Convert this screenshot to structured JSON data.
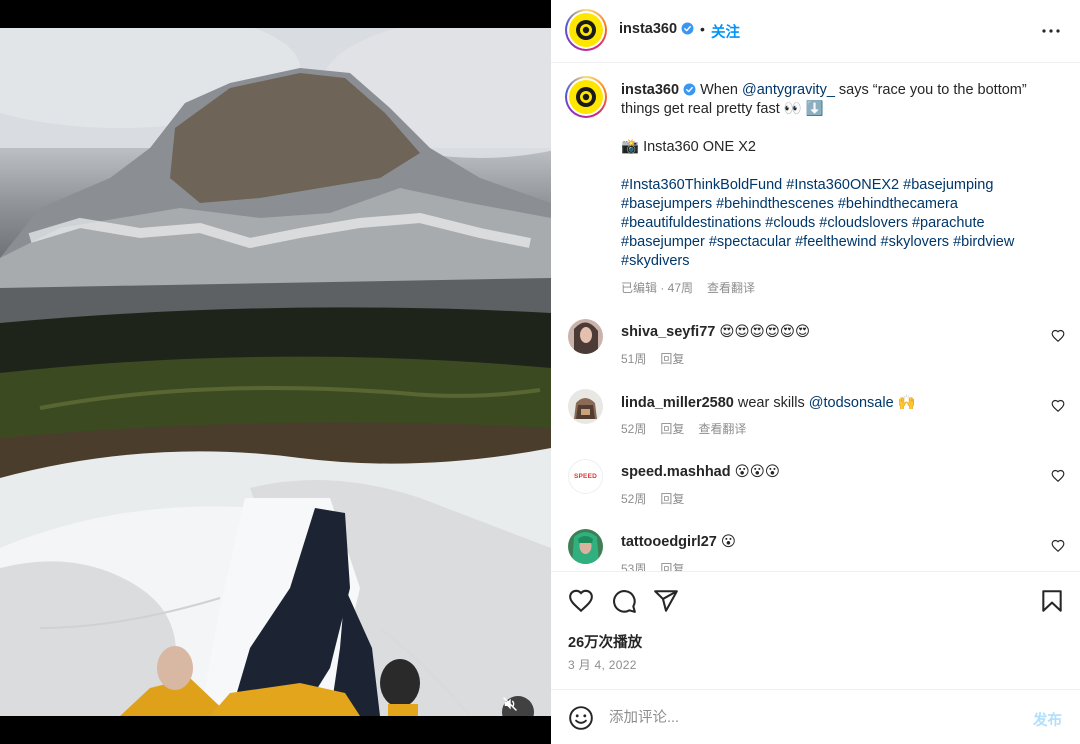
{
  "header": {
    "username": "insta360",
    "separator": "•",
    "follow_label": "关注"
  },
  "caption": {
    "username": "insta360",
    "text_before": "When ",
    "mention": "@antygravity_",
    "text_after": " says “race you to the bottom” things get real pretty fast 👀 ⬇️",
    "camera_line": "📸 Insta360 ONE X2",
    "hashtags": "#Insta360ThinkBoldFund #Insta360ONEX2 #basejumping #basejumpers #behindthescenes #behindthecamera #beautifuldestinations #clouds #cloudslovers #parachute #basejumper #spectacular #feelthewind #skylovers #birdview #skydivers",
    "edited_time": "已编辑 · 47周",
    "see_translation": "查看翻译"
  },
  "comments": [
    {
      "username": "shiva_seyfi77",
      "text": "😍😍😍😍😍😍",
      "mention": "",
      "time": "51周",
      "reply": "回复",
      "translate": ""
    },
    {
      "username": "linda_miller2580",
      "text": "wear skills ",
      "mention": "@todsonsale",
      "text_after": " 🙌",
      "time": "52周",
      "reply": "回复",
      "translate": "查看翻译"
    },
    {
      "username": "speed.mashhad",
      "text": "😮😮😮",
      "mention": "",
      "time": "52周",
      "reply": "回复",
      "translate": ""
    },
    {
      "username": "tattooedgirl27",
      "text": "😮",
      "mention": "",
      "time": "53周",
      "reply": "回复",
      "translate": ""
    }
  ],
  "speed_avatar_text": "SPEED",
  "stats": {
    "plays": "26万次播放",
    "date": "3 月 4, 2022"
  },
  "add_comment": {
    "placeholder": "添加评论...",
    "post_label": "发布"
  },
  "colors": {
    "accent_blue": "#0095f6",
    "link_blue": "#00376b",
    "muted": "#8e8e8e",
    "logo_yellow": "#ffe600"
  },
  "icons": [
    "verified-badge-icon",
    "more-options-icon",
    "heart-icon",
    "comment-icon",
    "share-icon",
    "bookmark-icon",
    "emoji-icon",
    "mute-icon"
  ]
}
